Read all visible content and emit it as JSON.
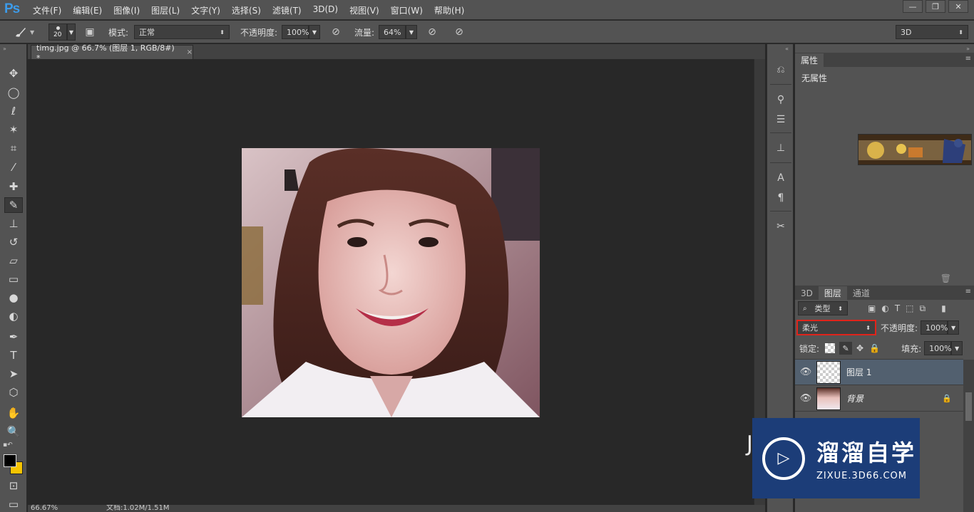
{
  "app": {
    "logo": "Ps"
  },
  "menu": [
    "文件(F)",
    "编辑(E)",
    "图像(I)",
    "图层(L)",
    "文字(Y)",
    "选择(S)",
    "滤镜(T)",
    "3D(D)",
    "视图(V)",
    "窗口(W)",
    "帮助(H)"
  ],
  "options": {
    "brush_size": "20",
    "mode_label": "模式:",
    "mode_value": "正常",
    "opacity_label": "不透明度:",
    "opacity_value": "100%",
    "flow_label": "流量:",
    "flow_value": "64%",
    "workspace": "3D"
  },
  "document": {
    "tab_title": "timg.jpg @ 66.7% (图层 1, RGB/8#) *",
    "close": "×"
  },
  "status": {
    "zoom": "66.67%",
    "doc_size": "文档:1.02M/1.51M"
  },
  "properties": {
    "tab": "属性",
    "content": "无属性"
  },
  "layers_panel": {
    "tabs": [
      "3D",
      "图层",
      "通道"
    ],
    "filter_kind": "类型",
    "blend_mode": "柔光",
    "opacity_label": "不透明度:",
    "opacity_value": "100%",
    "lock_label": "锁定:",
    "fill_label": "填充:",
    "fill_value": "100%",
    "layers": [
      {
        "name": "图层 1"
      },
      {
        "name": "背景"
      }
    ]
  },
  "watermark": {
    "title": "溜溜自学",
    "subtitle": "ZIXUE.3D66.COM",
    "side_char": "J"
  },
  "colors": {
    "accent": "#3d9be9",
    "selected_layer": "#52606f",
    "highlight_box": "#e0241b",
    "foreground": "#000000",
    "background": "#f5c400"
  },
  "icons": [
    "brush-icon",
    "move-icon",
    "marquee-icon",
    "lasso-icon",
    "magic-wand-icon",
    "crop-icon",
    "eyedropper-icon",
    "healing-icon",
    "stamp-icon",
    "history-brush-icon",
    "eraser-icon",
    "gradient-icon",
    "blur-icon",
    "dodge-icon",
    "pen-icon",
    "type-icon",
    "path-select-icon",
    "shape-icon",
    "hand-icon",
    "zoom-icon",
    "eye-icon",
    "lock-icon"
  ]
}
